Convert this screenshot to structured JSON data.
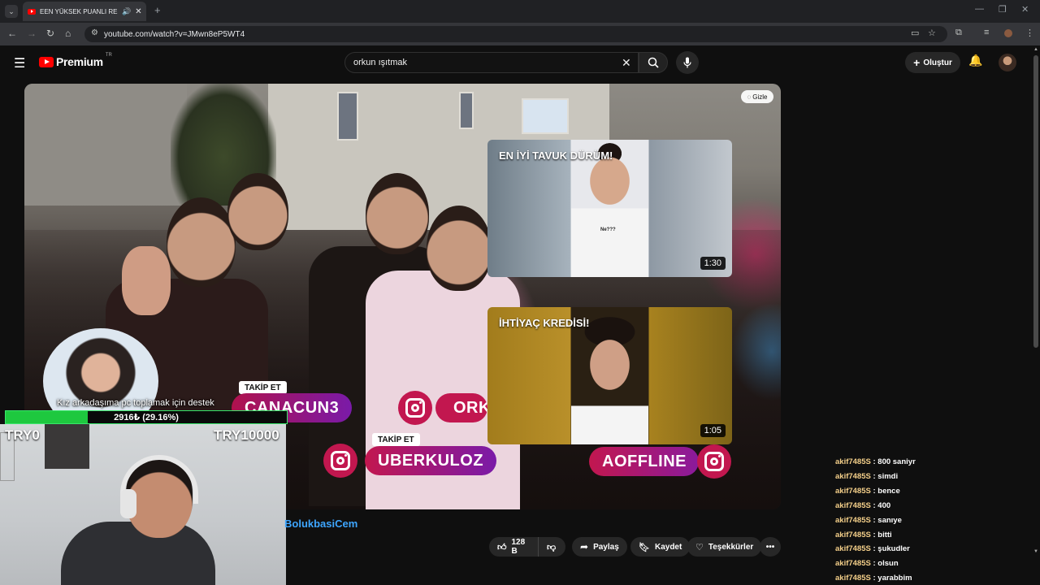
{
  "browser": {
    "tab_title": "EEN YÜKSEK PUANLI RESTORAN",
    "new_tab_icon": "plus-icon",
    "url": "youtube.com/watch?v=JMwn8eP5WT4"
  },
  "header": {
    "logo_text": "Premium",
    "region": "TR",
    "search_value": "orkun ışıtmak",
    "create_label": "Oluştur"
  },
  "video": {
    "hide_label": "Gizle",
    "cards": [
      {
        "title": "EN İYİ TAVUK DÜRÜM!",
        "duration": "1:30",
        "shirt_text": "Ne???"
      },
      {
        "title": "İHTİYAÇ KREDİSİ!",
        "duration": "1:05"
      }
    ],
    "stickers": {
      "follow_label_1": "TAKİP ET",
      "handle_1": "CANACUN3",
      "handle_2": "ORK",
      "follow_label_2": "TAKİP ET",
      "handle_3": "UBERKULOZ",
      "handle_4": "AOFFLINE"
    }
  },
  "overlay": {
    "donation_text": "Kız arkadaşıma pc toplamak için destek",
    "progress_text": "2916₺ (29.16%)",
    "progress_fraction": 0.2916,
    "min_label": "TRY0",
    "max_label": "TRY10000"
  },
  "below": {
    "channel_name": "BolukbasiCem",
    "like_count": "128 B",
    "share_label": "Paylaş",
    "save_label": "Kaydet",
    "thanks_label": "Teşekkürler"
  },
  "chat": [
    {
      "user": "akif7485S",
      "msg": "800 saniyr"
    },
    {
      "user": "akif7485S",
      "msg": "simdi"
    },
    {
      "user": "akif7485S",
      "msg": "bence"
    },
    {
      "user": "akif7485S",
      "msg": "400"
    },
    {
      "user": "akif7485S",
      "msg": "sanıye"
    },
    {
      "user": "akif7485S",
      "msg": "bitti"
    },
    {
      "user": "akif7485S",
      "msg": "şukudler"
    },
    {
      "user": "akif7485S",
      "msg": "olsun"
    },
    {
      "user": "akif7485S",
      "msg": "yarabbim"
    }
  ],
  "colors": {
    "youtube_red": "#ff0000",
    "progress_green": "#1ec83f",
    "chat_user": "#f5d08a",
    "link_blue": "#3ea6ff"
  }
}
